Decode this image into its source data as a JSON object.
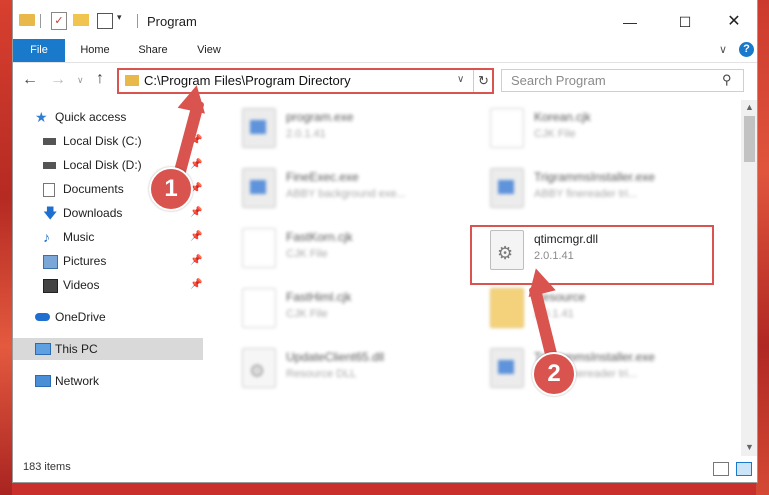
{
  "window": {
    "title": "Program"
  },
  "ribbon": {
    "tabs": [
      "File",
      "Home",
      "Share",
      "View"
    ]
  },
  "address": {
    "path": "C:\\Program Files\\Program Directory"
  },
  "search": {
    "placeholder": "Search Program"
  },
  "nav": {
    "items": [
      {
        "label": "Quick access",
        "icon": "star-icon",
        "pinned": false
      },
      {
        "label": "Local Disk (C:)",
        "icon": "drive-icon",
        "pinned": true
      },
      {
        "label": "Local Disk (D:)",
        "icon": "drive-icon",
        "pinned": true
      },
      {
        "label": "Documents",
        "icon": "documents-icon",
        "pinned": true
      },
      {
        "label": "Downloads",
        "icon": "downloads-icon",
        "pinned": true
      },
      {
        "label": "Music",
        "icon": "music-icon",
        "pinned": true
      },
      {
        "label": "Pictures",
        "icon": "pictures-icon",
        "pinned": true
      },
      {
        "label": "Videos",
        "icon": "videos-icon",
        "pinned": true
      },
      {
        "label": "OneDrive",
        "icon": "onedrive-icon",
        "pinned": false
      },
      {
        "label": "This PC",
        "icon": "this-pc-icon",
        "pinned": false,
        "selected": true
      },
      {
        "label": "Network",
        "icon": "network-icon",
        "pinned": false
      }
    ]
  },
  "files": [
    {
      "name": "program.exe",
      "desc": "2.0.1.41",
      "type": "exe",
      "highlight": false
    },
    {
      "name": "Korean.cjk",
      "desc": "CJK File",
      "type": "doc",
      "highlight": false
    },
    {
      "name": "FineExec.exe",
      "desc": "ABBY background exe...",
      "type": "exe",
      "highlight": false
    },
    {
      "name": "TrigrammsInstaller.exe",
      "desc": "ABBY finereader tri...",
      "type": "exe",
      "highlight": false
    },
    {
      "name": "FastKorn.cjk",
      "desc": "CJK File",
      "type": "doc",
      "highlight": false
    },
    {
      "name": "qtimcmgr.dll",
      "desc": "2.0.1.41",
      "type": "dll",
      "highlight": true
    },
    {
      "name": "FastHiml.cjk",
      "desc": "CJK File",
      "type": "doc",
      "highlight": false
    },
    {
      "name": "Resource",
      "desc": "2.0.1.41",
      "type": "folder",
      "highlight": false
    },
    {
      "name": "UpdateClient65.dll",
      "desc": "Resource DLL",
      "type": "dll",
      "highlight": false
    },
    {
      "name": "TrigrammsInstaller.exe",
      "desc": "ABBY finereader tri...",
      "type": "exe",
      "highlight": false
    }
  ],
  "status": {
    "items_count": "183 items"
  },
  "annotations": {
    "step1": "1",
    "step2": "2",
    "color": "#d9534f"
  }
}
